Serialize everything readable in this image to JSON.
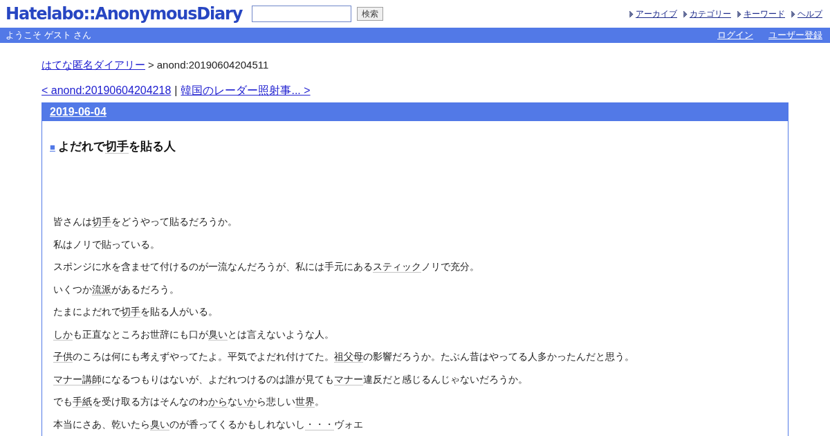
{
  "header": {
    "logo": "Hatelabo::AnonymousDiary",
    "search": {
      "button": "検索"
    },
    "links": [
      "アーカイブ",
      "カテゴリー",
      "キーワード",
      "ヘルプ"
    ]
  },
  "user_bar": {
    "greeting": "ようこそ ゲスト さん",
    "links": [
      "ログイン",
      "ユーザー登録"
    ]
  },
  "breadcrumb": {
    "home": "はてな匿名ダイアリー",
    "separator": ">",
    "current": "anond:20190604204511"
  },
  "pager": {
    "previous": "< anond:20190604204218",
    "separator": "|",
    "next": "韓国のレーダー照射事... >"
  },
  "day": {
    "date": "2019-06-04",
    "entry": {
      "anchor": "■",
      "title": [
        {
          "text": "よだれで",
          "keyword": false
        },
        {
          "text": "切手",
          "keyword": true
        },
        {
          "text": "を貼る人",
          "keyword": false
        }
      ],
      "paragraphs": [
        [
          {
            "text": "皆さんは",
            "keyword": false
          },
          {
            "text": "切手",
            "keyword": true
          },
          {
            "text": "をどうやって貼るだろうか。",
            "keyword": false
          }
        ],
        [
          {
            "text": "私はノリで貼っている。",
            "keyword": false
          }
        ],
        [
          {
            "text": "スポンジに水を含ませて付けるのが一流なんだろうが、私には手元にある",
            "keyword": false
          },
          {
            "text": "スティック",
            "keyword": true
          },
          {
            "text": "ノリで充分。",
            "keyword": false
          }
        ],
        [
          {
            "text": "いくつか",
            "keyword": false
          },
          {
            "text": "流派",
            "keyword": true
          },
          {
            "text": "があるだろう。",
            "keyword": false
          }
        ],
        [
          {
            "text": "たまによだれで",
            "keyword": false
          },
          {
            "text": "切手",
            "keyword": true
          },
          {
            "text": "を貼る人がいる。",
            "keyword": false
          }
        ],
        [
          {
            "text": "しか",
            "keyword": true
          },
          {
            "text": "も正直なところお世辞にも口が",
            "keyword": false
          },
          {
            "text": "臭い",
            "keyword": true
          },
          {
            "text": "とは言えないような人。",
            "keyword": false
          }
        ],
        [
          {
            "text": "子供",
            "keyword": true
          },
          {
            "text": "のころは何にも考えずやってたよ。平気でよだれ付けてた。",
            "keyword": false
          },
          {
            "text": "祖父母",
            "keyword": true
          },
          {
            "text": "の影響だろうか。たぶん昔はやってる人多かったんだと思う。",
            "keyword": false
          }
        ],
        [
          {
            "text": "マナー講師",
            "keyword": true
          },
          {
            "text": "になるつもりはないが、よだれつけるのは誰が見ても",
            "keyword": false
          },
          {
            "text": "マナー",
            "keyword": true
          },
          {
            "text": "違反だと感じるんじゃないだろうか。",
            "keyword": false
          }
        ],
        [
          {
            "text": "でも",
            "keyword": false
          },
          {
            "text": "手紙",
            "keyword": true
          },
          {
            "text": "を受け取る方はそんなのわ",
            "keyword": false
          },
          {
            "text": "から",
            "keyword": true
          },
          {
            "text": "な",
            "keyword": false
          },
          {
            "text": "いか",
            "keyword": true
          },
          {
            "text": "ら悲しい",
            "keyword": false
          },
          {
            "text": "世界",
            "keyword": true
          },
          {
            "text": "。",
            "keyword": false
          }
        ],
        [
          {
            "text": "本当にさあ、乾いたら",
            "keyword": false
          },
          {
            "text": "臭い",
            "keyword": true
          },
          {
            "text": "のが香ってくるかもしれないし",
            "keyword": false
          },
          {
            "text": "・・・",
            "keyword": true
          },
          {
            "text": "ヴォエ",
            "keyword": false
          }
        ]
      ]
    }
  }
}
